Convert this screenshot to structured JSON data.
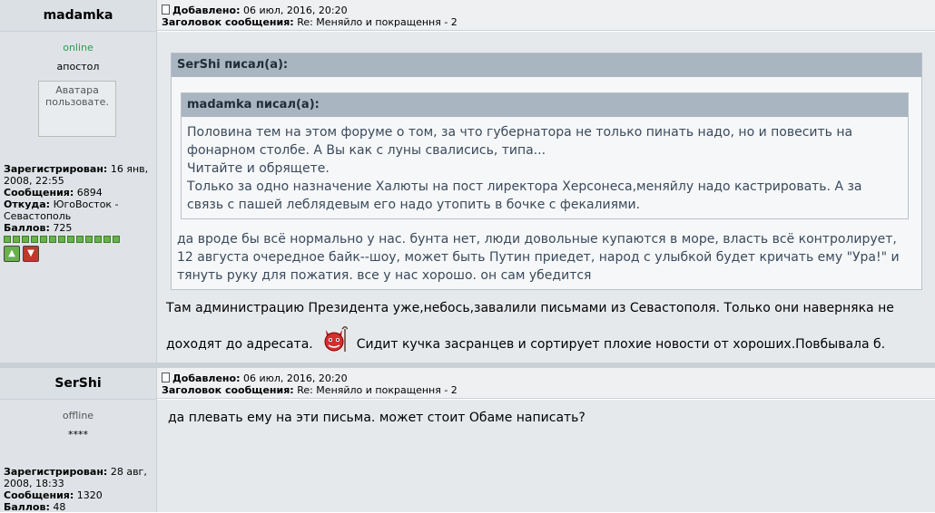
{
  "posts": [
    {
      "author": "madamka",
      "status": "online",
      "rank": "апостол",
      "avatar_alt": "Аватара пользовате.",
      "posted_label": "Добавлено:",
      "posted_value": "06 июл, 2016, 20:20",
      "subject_label": "Заголовок сообщения:",
      "subject_value": "Re: Меняйло и покращення - 2",
      "reg_label": "Зарегистрирован:",
      "reg_value": "16 янв, 2008, 22:55",
      "msgs_label": "Сообщения:",
      "msgs_value": "6894",
      "from_label": "Откуда:",
      "from_value": "ЮгоВосток - Севастополь",
      "points_label": "Баллов:",
      "points_value": "725",
      "outer_quote": {
        "title": "SerShi писал(а):",
        "inner_quote": {
          "title": "madamka писал(а):",
          "lines": [
            "Половина тем на этом форуме о том, за что губернатора не только пинать надо, но и повесить на",
            "фонарном столбе. А Вы как с луны свалисись, типа...",
            "Читайте и обрящете.",
            "Только за одно назначение Халюты на пост лиректора Херсонеса,меняйлу надо кастрировать. А за",
            "связь с пашей леблядевым его надо утопить в бочке с фекалиями."
          ]
        },
        "lines": [
          "да вроде бы всё нормально у нас. бунта нет, люди довольные купаются в море, власть всё контролирует,",
          "12 августа очередное байк--шоу, может быть Путин приедет, народ с улыбкой будет кричать ему \"Ура!\" и",
          "тянуть руку для пожатия. все у нас хорошо. он сам убедится"
        ]
      },
      "text_line1": "Там администрацию Президента уже,небось,завалили письмами из Севастополя. Только они наверняка не",
      "text_line2a": "доходят до адресата.",
      "text_line2b": "Сидит кучка засранцев и сортирует плохие новости от хороших.Повбывала б."
    },
    {
      "author": "SerShi",
      "status": "offline",
      "rank": "****",
      "posted_label": "Добавлено:",
      "posted_value": "06 июл, 2016, 20:20",
      "subject_label": "Заголовок сообщения:",
      "subject_value": "Re: Меняйло и покращення - 2",
      "reg_label": "Зарегистрирован:",
      "reg_value": "28 авг, 2008, 18:33",
      "msgs_label": "Сообщения:",
      "msgs_value": "1320",
      "points_label": "Баллов:",
      "points_value": "48",
      "text": "да плевать ему на эти письма. может стоит Обаме написать?"
    }
  ]
}
